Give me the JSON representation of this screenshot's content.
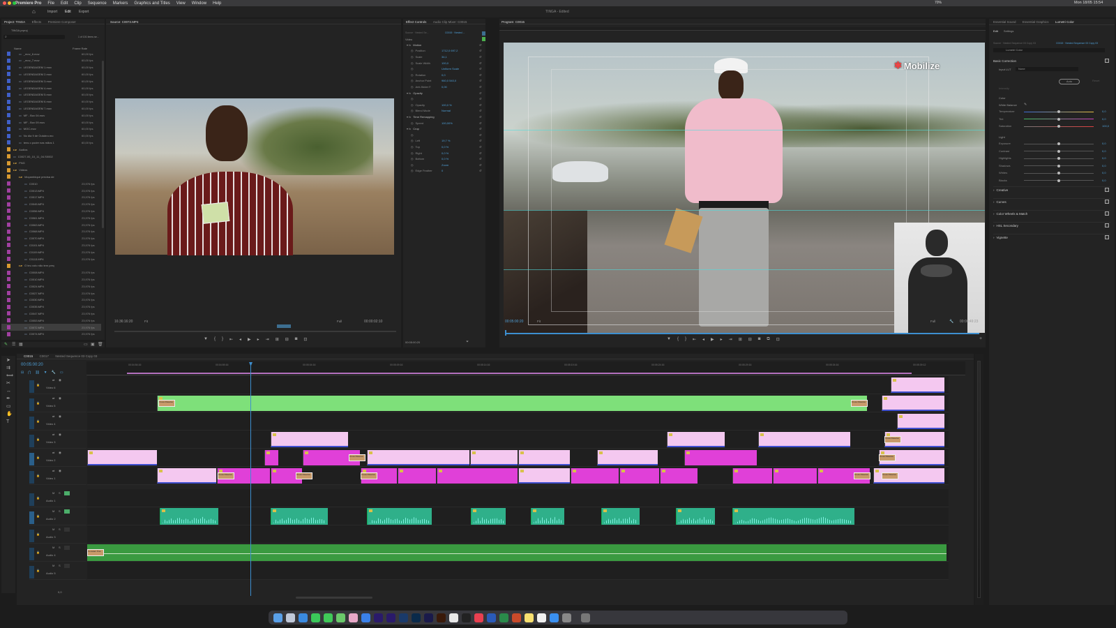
{
  "menubar": {
    "app_name": "Premiere Pro",
    "menus": [
      "File",
      "Edit",
      "Clip",
      "Sequence",
      "Markers",
      "Graphics and Titles",
      "View",
      "Window",
      "Help"
    ],
    "clock": "Mon 18/05 15:54",
    "battery": "70%"
  },
  "header": {
    "workspaces": [
      "Import",
      "Edit",
      "Export"
    ],
    "active_workspace": "Edit",
    "document_title": "TINGA - Edited"
  },
  "project": {
    "tabs": [
      "Project: TINGA",
      "Effects",
      "Premiere Composer"
    ],
    "breadcrumb": "TINGA.prproj",
    "item_count": "1 of 101 items se...",
    "columns": [
      "Name",
      "Frame Rate"
    ],
    "items": [
      {
        "name": "_mov_6.mov",
        "fr": "60,00 fps",
        "color": "#4060c8",
        "level": 1
      },
      {
        "name": "_mov_7.mov",
        "fr": "60,00 fps",
        "color": "#4060c8",
        "level": 1
      },
      {
        "name": "LEGENDAGEM 1.mov",
        "fr": "60,00 fps",
        "color": "#4060c8",
        "level": 1
      },
      {
        "name": "LEGENDAGEM 2.mov",
        "fr": "60,00 fps",
        "color": "#4060c8",
        "level": 1
      },
      {
        "name": "LEGENDAGEM 3.mov",
        "fr": "60,00 fps",
        "color": "#4060c8",
        "level": 1
      },
      {
        "name": "LEGENDAGEM 4.mov",
        "fr": "60,00 fps",
        "color": "#4060c8",
        "level": 1
      },
      {
        "name": "LEGENDAGEM 5.mov",
        "fr": "60,00 fps",
        "color": "#4060c8",
        "level": 1
      },
      {
        "name": "LEGENDAGEM 6.mov",
        "fr": "60,00 fps",
        "color": "#4060c8",
        "level": 1
      },
      {
        "name": "LEGENDAGEM 7.mov",
        "fr": "60,00 fps",
        "color": "#4060c8",
        "level": 1
      },
      {
        "name": "MF - Box 04.mov",
        "fr": "60,00 fps",
        "color": "#4060c8",
        "level": 1
      },
      {
        "name": "MF - Box 09.mov",
        "fr": "60,00 fps",
        "color": "#4060c8",
        "level": 1
      },
      {
        "name": "MOC.mov",
        "fr": "60,00 fps",
        "color": "#4060c8",
        "level": 1
      },
      {
        "name": "No dia 9 de Outubro.mo",
        "fr": "60,00 fps",
        "color": "#4060c8",
        "level": 1
      },
      {
        "name": "tens o poder nas mãos 1",
        "fr": "60,00 fps",
        "color": "#4060c8",
        "level": 1
      },
      {
        "name": "Audios",
        "fr": "",
        "color": "#d89a30",
        "level": 0,
        "folder": true
      },
      {
        "name": "C0027-00_10_11_04.S0002",
        "fr": "",
        "color": "#d89a30",
        "level": 0
      },
      {
        "name": "PNG",
        "fr": "",
        "color": "#d89a30",
        "level": 0,
        "folder": true
      },
      {
        "name": "Videos",
        "fr": "",
        "color": "#d89a30",
        "level": 0,
        "folder": true
      },
      {
        "name": "Moçambique precisa de",
        "fr": "",
        "color": "#d89a30",
        "level": 1,
        "folder": true
      },
      {
        "name": "C0010",
        "fr": "23,976 fps",
        "color": "#a040a0",
        "level": 2
      },
      {
        "name": "C0013.MP4",
        "fr": "23,976 fps",
        "color": "#a040a0",
        "level": 2
      },
      {
        "name": "C0017.MP4",
        "fr": "23,976 fps",
        "color": "#a040a0",
        "level": 2
      },
      {
        "name": "C0045.MP4",
        "fr": "23,976 fps",
        "color": "#a040a0",
        "level": 2
      },
      {
        "name": "C0056.MP4",
        "fr": "23,976 fps",
        "color": "#a040a0",
        "level": 2
      },
      {
        "name": "C0061.MP4",
        "fr": "23,976 fps",
        "color": "#a040a0",
        "level": 2
      },
      {
        "name": "C0063.MP4",
        "fr": "23,976 fps",
        "color": "#a040a0",
        "level": 2
      },
      {
        "name": "C0068.MP4",
        "fr": "23,976 fps",
        "color": "#a040a0",
        "level": 2
      },
      {
        "name": "C0070.MP4",
        "fr": "23,976 fps",
        "color": "#a040a0",
        "level": 2
      },
      {
        "name": "C0101.MP4",
        "fr": "23,976 fps",
        "color": "#a040a0",
        "level": 2
      },
      {
        "name": "C0109.MP4",
        "fr": "23,976 fps",
        "color": "#a040a0",
        "level": 2
      },
      {
        "name": "C0113.MP4",
        "fr": "23,976 fps",
        "color": "#a040a0",
        "level": 2
      },
      {
        "name": "O teu voto não tem preç",
        "fr": "",
        "color": "#d89a30",
        "level": 1,
        "folder": true
      },
      {
        "name": "C0008.MP4",
        "fr": "23,976 fps",
        "color": "#a040a0",
        "level": 2
      },
      {
        "name": "C0010.MP4",
        "fr": "23,976 fps",
        "color": "#a040a0",
        "level": 2
      },
      {
        "name": "C0024.MP4",
        "fr": "23,976 fps",
        "color": "#a040a0",
        "level": 2
      },
      {
        "name": "C0027.MP4",
        "fr": "23,976 fps",
        "color": "#a040a0",
        "level": 2
      },
      {
        "name": "C0030.MP4",
        "fr": "23,976 fps",
        "color": "#a040a0",
        "level": 2
      },
      {
        "name": "C0035.MP4",
        "fr": "23,976 fps",
        "color": "#a040a0",
        "level": 2
      },
      {
        "name": "C0047.MP4",
        "fr": "23,976 fps",
        "color": "#a040a0",
        "level": 2
      },
      {
        "name": "C0053.MP4",
        "fr": "23,976 fps",
        "color": "#a040a0",
        "level": 2
      },
      {
        "name": "C0072.MP4",
        "fr": "23,976 fps",
        "color": "#a040a0",
        "level": 2,
        "selected": true
      },
      {
        "name": "C0074.MP4",
        "fr": "23,976 fps",
        "color": "#a040a0",
        "level": 2
      }
    ]
  },
  "source": {
    "tab": "Source: C0072.MP4",
    "timecode": "16:36:16:20",
    "fit": "Fit",
    "quality": "Full",
    "duration": "00:00:02:10"
  },
  "effect_controls": {
    "tabs": [
      "Effect Controls",
      "Audio Clip Mixer: C0015"
    ],
    "source_label": "Source · Nested Se...",
    "clip_label": "C0015 · Nested ...",
    "section": "Video",
    "rows": [
      {
        "label": "Motion",
        "value": "",
        "group": true
      },
      {
        "label": "Position",
        "value": "1712,0    697,2"
      },
      {
        "label": "Scale",
        "value": "34,1"
      },
      {
        "label": "Scale Width",
        "value": "100,0"
      },
      {
        "label": "",
        "value": "Uniform Scale"
      },
      {
        "label": "Rotation",
        "value": "0,0"
      },
      {
        "label": "Anchor Point",
        "value": "960,0    540,0"
      },
      {
        "label": "Anti-flicker F.",
        "value": "0,00"
      },
      {
        "label": "Opacity",
        "value": "",
        "group": true
      },
      {
        "label": "",
        "value": ""
      },
      {
        "label": "Opacity",
        "value": "100,0 %"
      },
      {
        "label": "Blend Mode",
        "value": "Normal"
      },
      {
        "label": "Time Remapping",
        "value": "",
        "group": true
      },
      {
        "label": "Speed",
        "value": "100,00%"
      },
      {
        "label": "Crop",
        "value": "",
        "group": true
      },
      {
        "label": "",
        "value": ""
      },
      {
        "label": "Left",
        "value": "19,7 %"
      },
      {
        "label": "Top",
        "value": "0,0 %"
      },
      {
        "label": "Right",
        "value": "0,0 %"
      },
      {
        "label": "Bottom",
        "value": "0,0 %"
      },
      {
        "label": "",
        "value": "Zoom"
      },
      {
        "label": "Edge Feather",
        "value": "0"
      }
    ],
    "timecode": "00:05:00:20"
  },
  "program": {
    "tab": "Program: C0015",
    "timecode": "00:05:00:20",
    "fit": "Fit",
    "quality": "Full",
    "duration": "00:00:49:23",
    "overlay_logo": "Mobilize"
  },
  "timeline": {
    "tabs": [
      "C0015",
      "C0017",
      "Nested Sequence 03 Copy 03"
    ],
    "timecode": "00:05:00:20",
    "ruler": [
      "00:04:54:16",
      "00:04:59:16",
      "00:05:04:16",
      "00:05:09:16",
      "00:05:14:16",
      "00:05:19:16",
      "00:05:24:16",
      "00:05:29:16",
      "00:05:34:16",
      "00:05:39:12"
    ],
    "video_tracks": [
      "Video 6",
      "Video 5",
      "Video 4",
      "Video 3",
      "Video 2",
      "Video 1"
    ],
    "audio_tracks": [
      "Audio 1",
      "Audio 2",
      "Audio 3",
      "Audio 4",
      "Audio 5"
    ],
    "transition_label": "Cross Dissolve",
    "audio_transition_label": "Constant Pow",
    "mix_value": "0,0"
  },
  "lumetri": {
    "tabs": [
      "Essential Sound",
      "Essential Graphics",
      "Lumetri Color"
    ],
    "subtabs": [
      "Edit",
      "Settings"
    ],
    "source_label": "Source · Nested Sequence 03 Copy 03",
    "target_label": "C0015 · Nested Sequence 03 Copy 03",
    "effect": "Lumetri Color",
    "basic_correction": "Basic Correction",
    "input_lut_label": "Input LUT",
    "input_lut": "None",
    "auto": "Auto",
    "reset": "Reset",
    "intensity": "Intensity",
    "color_heading": "Color",
    "white_balance": "White Balance",
    "color_sliders": [
      {
        "label": "Temperature",
        "value": "0,0"
      },
      {
        "label": "Tint",
        "value": "0,0"
      },
      {
        "label": "Saturation",
        "value": "100,0"
      }
    ],
    "light_heading": "Light",
    "light_sliders": [
      {
        "label": "Exposure",
        "value": "0,0"
      },
      {
        "label": "Contrast",
        "value": "0,0"
      },
      {
        "label": "Highlights",
        "value": "0,0"
      },
      {
        "label": "Shadows",
        "value": "0,0"
      },
      {
        "label": "Whites",
        "value": "0,0"
      },
      {
        "label": "Blacks",
        "value": "0,0"
      }
    ],
    "sections": [
      "Creative",
      "Curves",
      "Color Wheels & Match",
      "HSL Secondary",
      "Vignette"
    ]
  },
  "colors": {
    "accent_blue": "#4fa0d8",
    "clip_green": "#7ee07a",
    "clip_pink": "#f4c8f0",
    "clip_magenta": "#e040d8",
    "audio_teal": "#2fb08a",
    "audio_green": "#3a9a40",
    "playhead": "#3d8fd0"
  },
  "dock": [
    "Finder",
    "Launchpad",
    "Safari",
    "WhatsApp",
    "Messages",
    "Maps",
    "Photos",
    "Mail",
    "Adobe Effects",
    "Premiere Pro",
    "Lightroom Classic",
    "Photoshop",
    "Media Encoder",
    "Illustrator",
    "Chrome",
    "Capcut",
    "Music",
    "Word",
    "Excel",
    "PowerPoint",
    "Notes",
    "Calendar",
    "App Store",
    "Settings",
    "Trash"
  ]
}
